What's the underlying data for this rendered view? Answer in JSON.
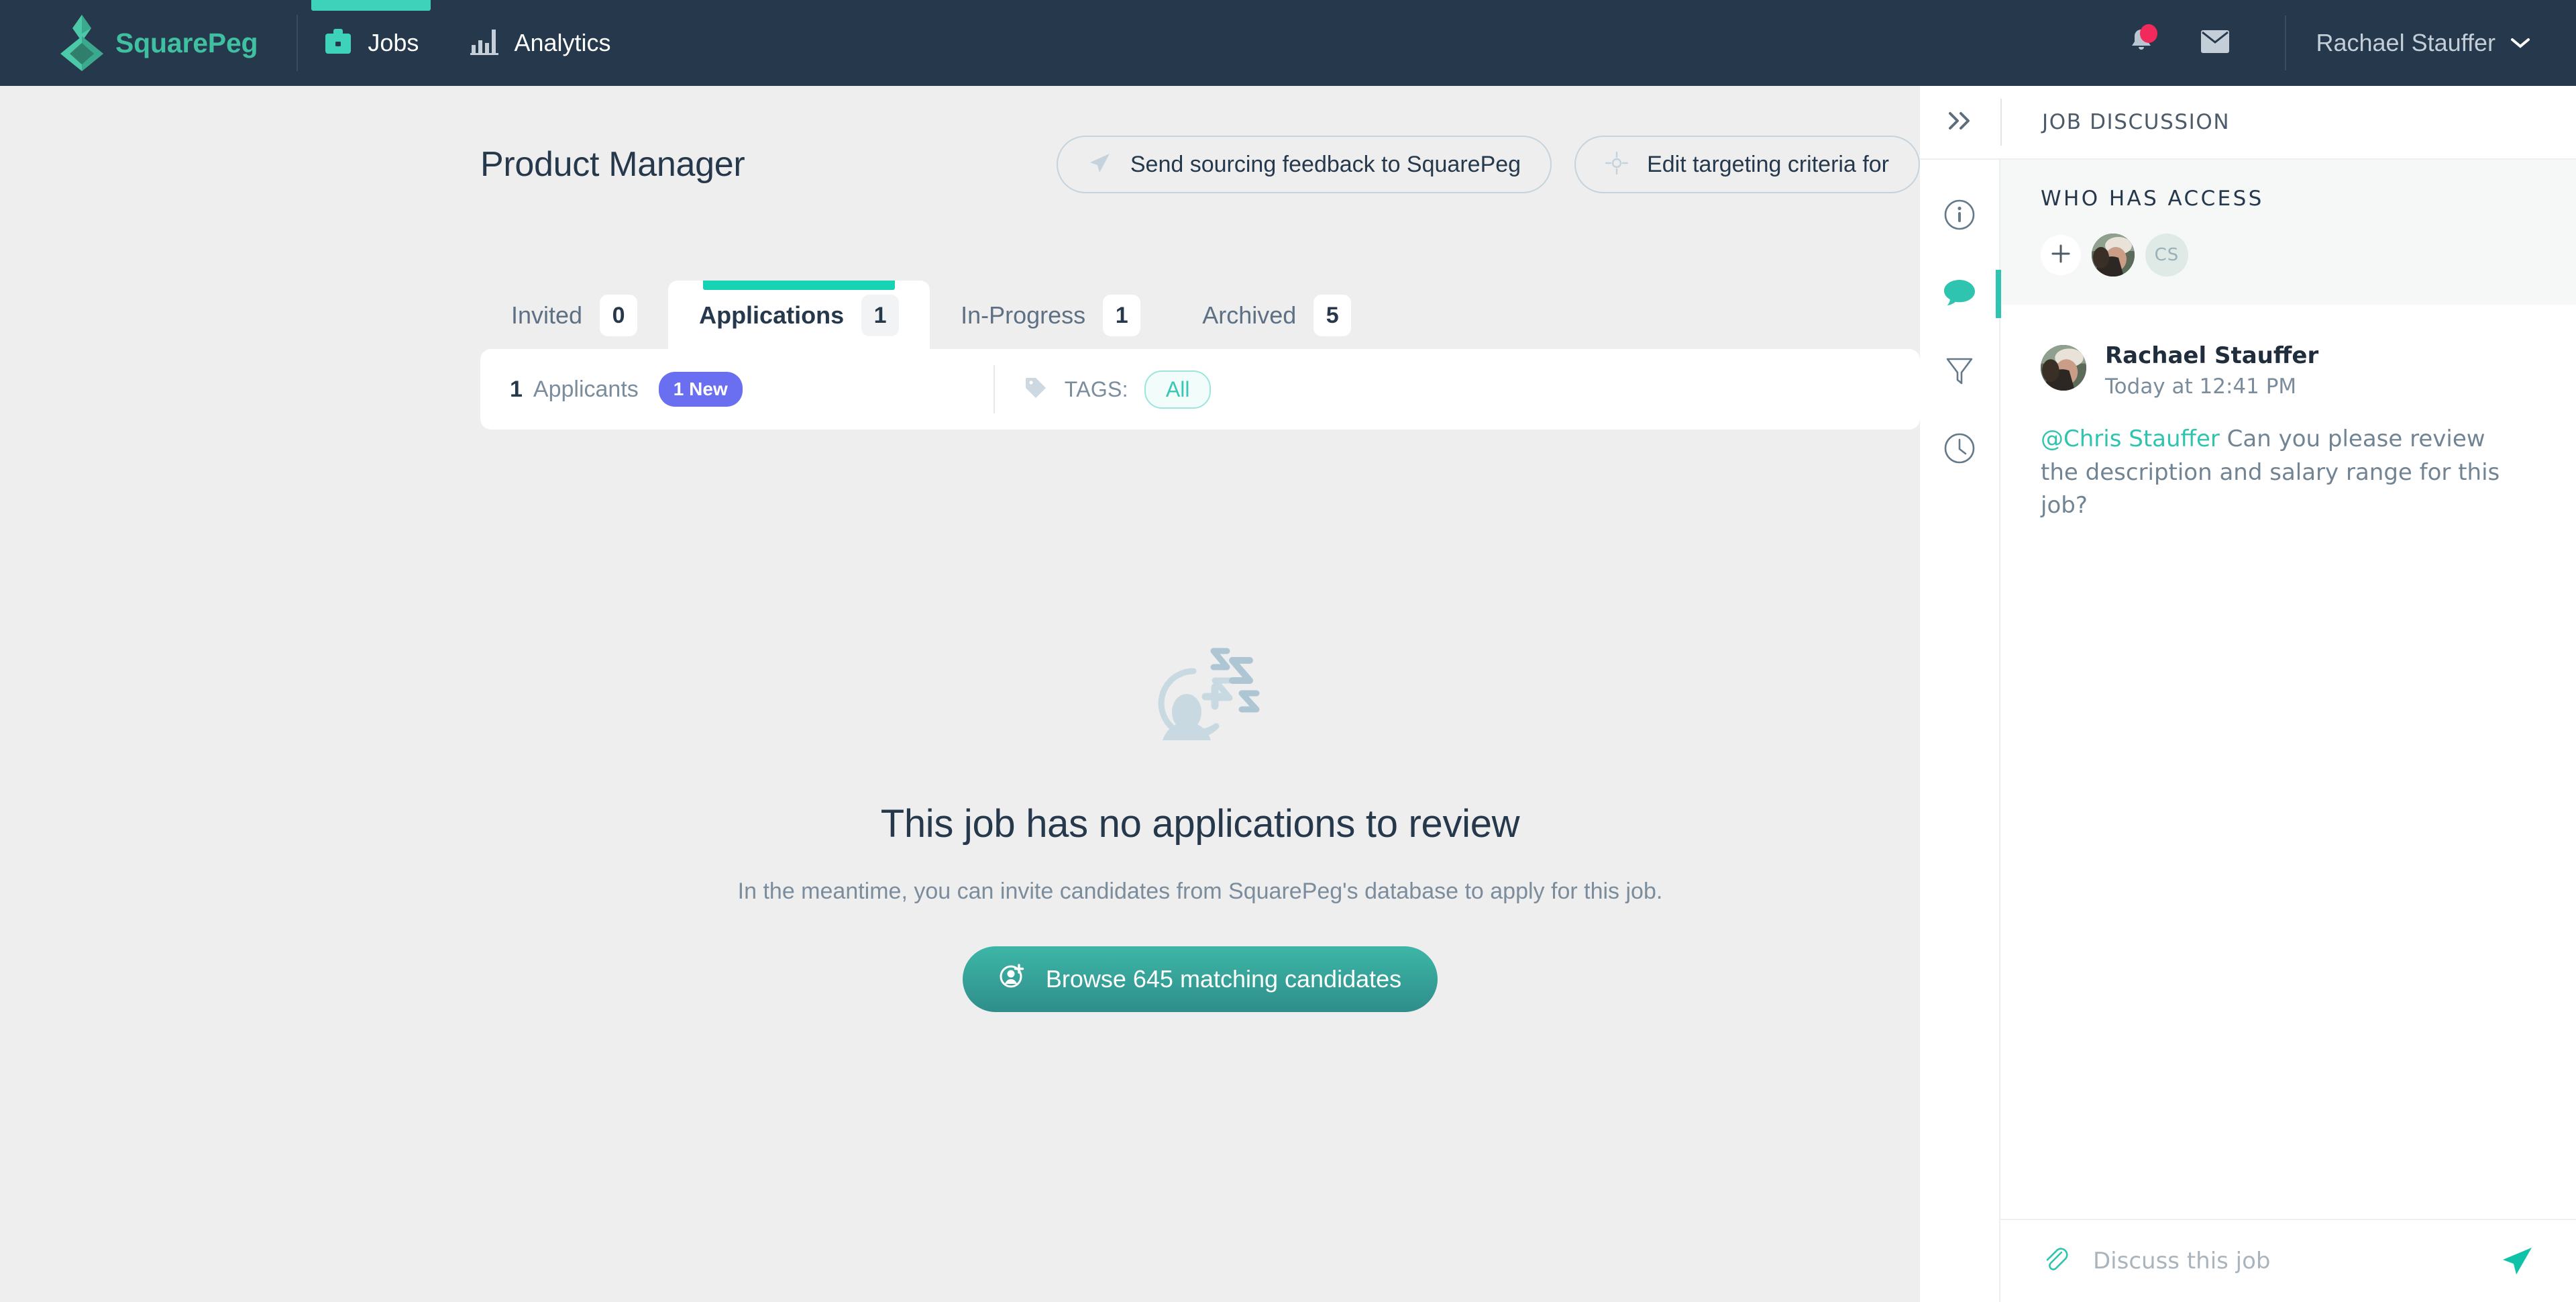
{
  "brand": {
    "name": "SquarePeg",
    "logo_icon": "squarepeg-diamond-logo"
  },
  "topnav": {
    "items": [
      {
        "label": "Jobs",
        "icon": "briefcase-icon",
        "active": true
      },
      {
        "label": "Analytics",
        "icon": "bar-chart-icon",
        "active": false
      }
    ],
    "notifications_icon": "bell-icon",
    "notifications_has_unread": true,
    "messages_icon": "envelope-icon",
    "user": {
      "name": "Rachael Stauffer",
      "caret_icon": "chevron-down-icon"
    }
  },
  "page": {
    "title": "Product Manager",
    "actions": [
      {
        "label": "Send sourcing feedback to SquarePeg",
        "icon": "paper-plane-icon"
      },
      {
        "label": "Edit targeting criteria for",
        "icon": "target-icon"
      }
    ]
  },
  "tabs": [
    {
      "label": "Invited",
      "count": "0",
      "active": false
    },
    {
      "label": "Applications",
      "count": "1",
      "active": true
    },
    {
      "label": "In-Progress",
      "count": "1",
      "active": false
    },
    {
      "label": "Archived",
      "count": "5",
      "active": false
    }
  ],
  "filter_bar": {
    "applicants_count": "1",
    "applicants_label": "Applicants",
    "new_badge": "1 New",
    "tags_icon": "tag-icon",
    "tags_label": "TAGS:",
    "tag_selected": "All"
  },
  "empty_state": {
    "illustration_icon": "sleeping-candidate-icon",
    "title": "This job has no applications to review",
    "subtitle": "In the meantime, you can invite candidates from SquarePeg's database to apply for this job.",
    "cta_label": "Browse 645 matching candidates",
    "cta_icon": "add-person-icon",
    "cta_color": "#35a296"
  },
  "panel": {
    "collapse_icon": "double-chevron-right-icon",
    "title": "JOB DISCUSSION",
    "rail": [
      {
        "icon": "info-circle-icon",
        "name": "details",
        "active": false
      },
      {
        "icon": "comment-bubble-icon",
        "name": "discussion",
        "active": true
      },
      {
        "icon": "funnel-icon",
        "name": "pipeline",
        "active": false
      },
      {
        "icon": "clock-icon",
        "name": "history",
        "active": false
      }
    ],
    "access": {
      "title": "WHO HAS ACCESS",
      "add_icon": "plus-icon",
      "members": [
        {
          "type": "photo",
          "name": "Rachael Stauffer"
        },
        {
          "type": "initials",
          "initials": "CS",
          "name": "Chris Stauffer"
        }
      ]
    },
    "messages": [
      {
        "author": "Rachael Stauffer",
        "time": "Today at 12:41 PM",
        "mention": "@Chris Stauffer",
        "body": " Can you please review the description and salary range for this job?"
      }
    ],
    "composer": {
      "attach_icon": "paperclip-icon",
      "placeholder": "Discuss this job",
      "value": "",
      "send_icon": "send-paper-plane-icon"
    }
  },
  "colors": {
    "nav_bg": "#26384b",
    "accent_teal": "#3fd2bb",
    "brand_green": "#3fc0a0",
    "page_bg": "#eeeeee",
    "badge_purple": "#6a6ef0",
    "notification_red": "#f2295b"
  }
}
